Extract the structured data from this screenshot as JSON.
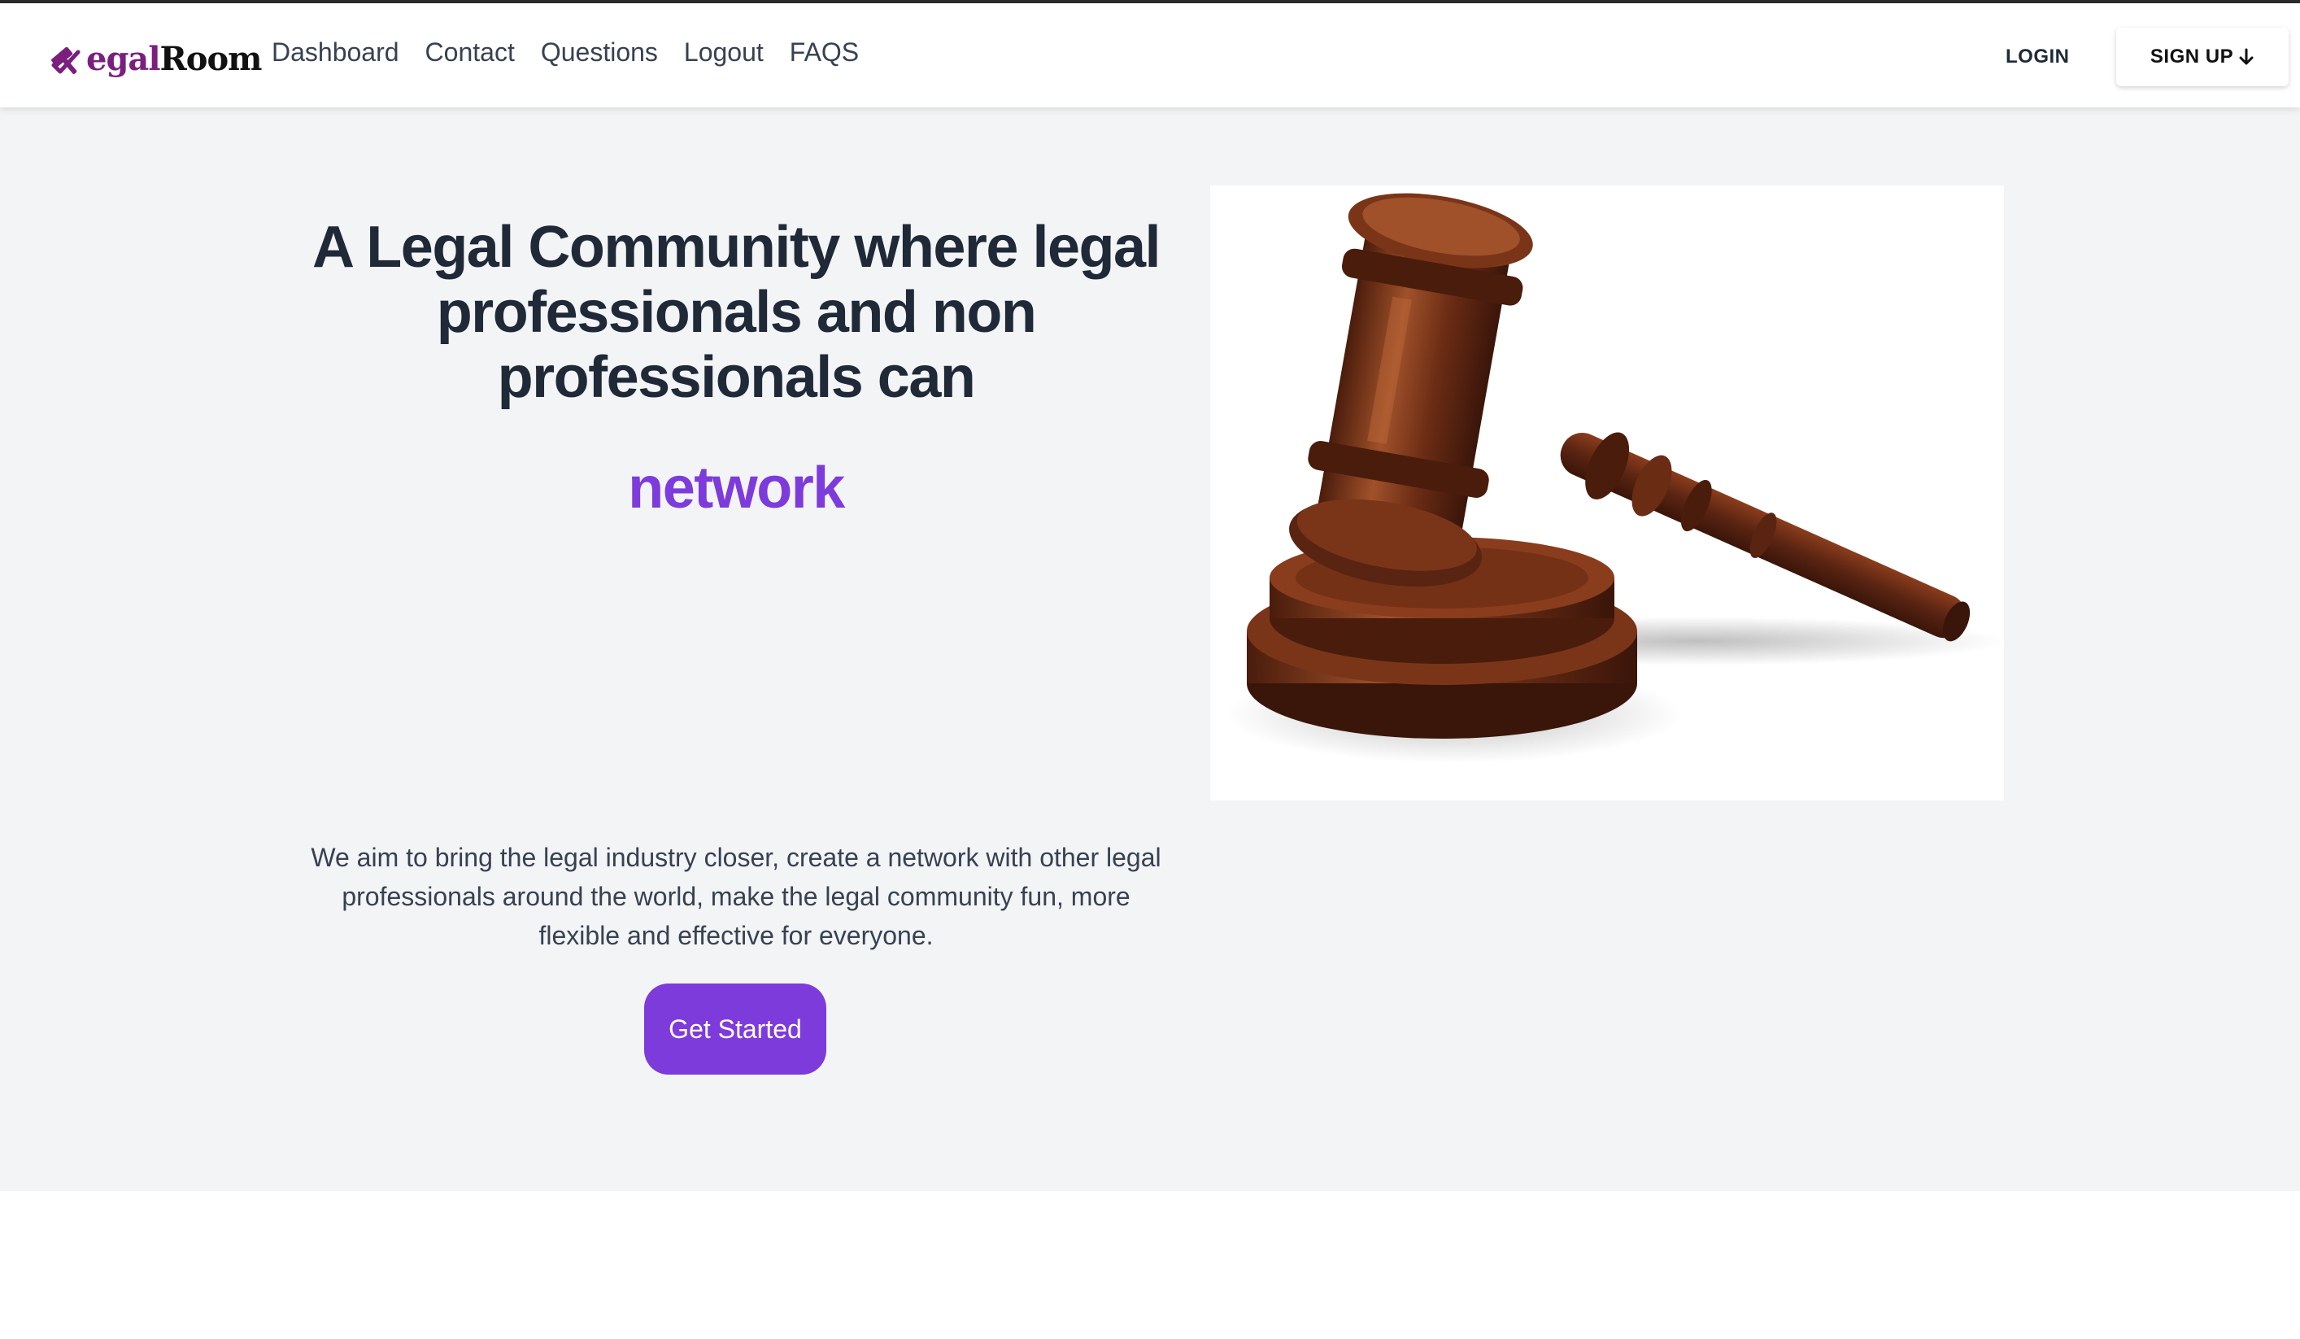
{
  "brand": {
    "name_prefix": "egal",
    "name_suffix": "Room"
  },
  "nav": {
    "items": [
      {
        "label": "Dashboard"
      },
      {
        "label": "Contact"
      },
      {
        "label": "Questions"
      },
      {
        "label": "Logout"
      },
      {
        "label": "FAQS"
      }
    ],
    "login_label": "LOGIN",
    "signup_label": "SIGN UP"
  },
  "hero": {
    "headline": "A Legal Community where legal professionals and non professionals can",
    "rotating_word": "network",
    "description": "We aim to bring the legal industry closer, create a network with other legal professionals around the world, make the legal community fun, more flexible and effective for everyone.",
    "cta_label": "Get Started"
  },
  "colors": {
    "accent": "#7e3bdb",
    "logo_accent": "#7b1f7f",
    "hero_background": "#f3f4f6",
    "text_dark": "#1f2937"
  },
  "icons": {
    "logo": "gavel-logo-icon",
    "signup": "arrow-down-icon",
    "hero_image": "gavel-image"
  }
}
